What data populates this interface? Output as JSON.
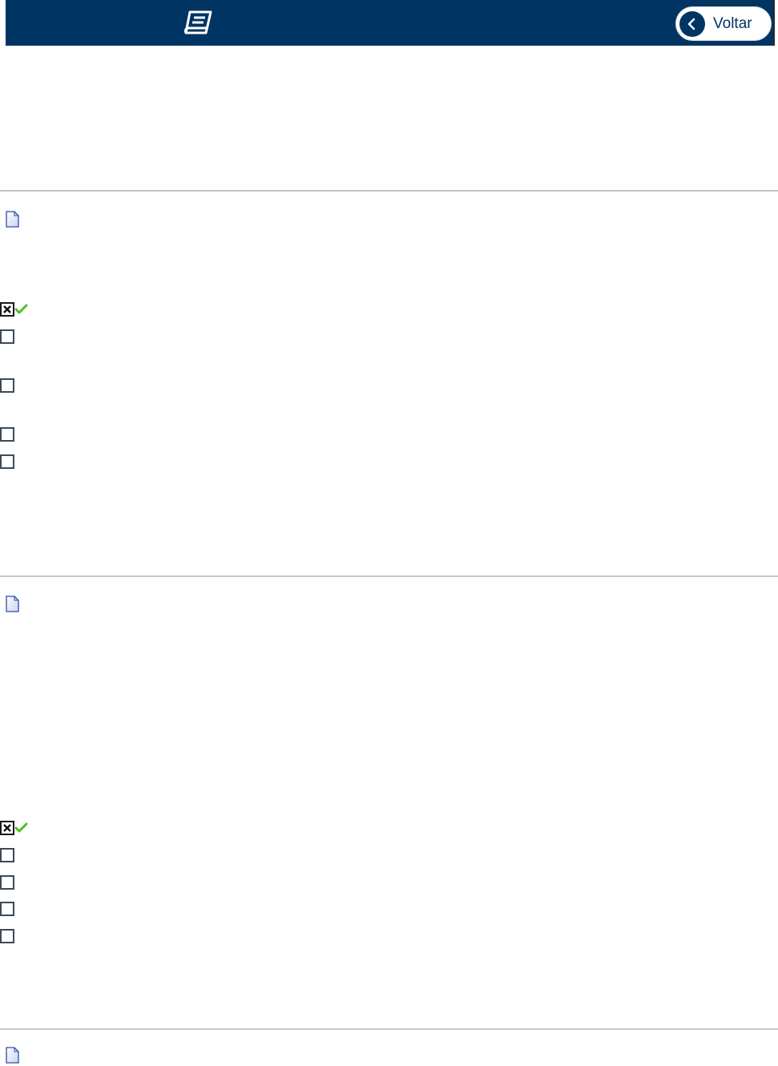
{
  "header": {
    "background_color": "#003462",
    "logo_icon": "book-icon",
    "back_button": {
      "label": "Voltar",
      "icon": "chevron-left-icon"
    }
  },
  "questions": [
    {
      "icon": "document-icon",
      "options": [
        {
          "state": "marked",
          "correct": true
        },
        {
          "state": "unmarked"
        },
        {
          "state": "unmarked"
        },
        {
          "state": "unmarked"
        },
        {
          "state": "unmarked"
        }
      ]
    },
    {
      "icon": "document-icon",
      "options": [
        {
          "state": "marked",
          "correct": true
        },
        {
          "state": "unmarked"
        },
        {
          "state": "unmarked"
        },
        {
          "state": "unmarked"
        },
        {
          "state": "unmarked"
        }
      ]
    },
    {
      "icon": "document-icon",
      "options": []
    }
  ],
  "colors": {
    "checkmark": "#4fbf1f",
    "document_icon": "#2f4fa8"
  }
}
